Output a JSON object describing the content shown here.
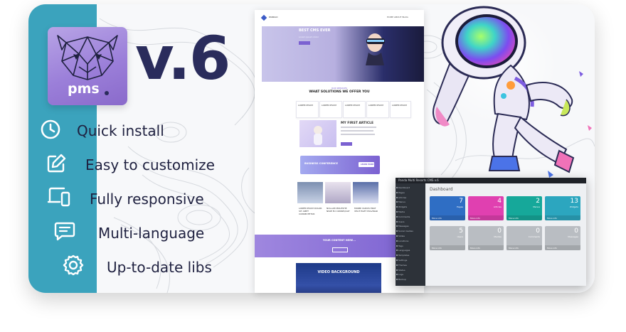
{
  "brand": {
    "logo_text": "pms",
    "version": "v.6",
    "colors": {
      "accent": "#3ba3bd",
      "logo_bg": "#9b7fd9",
      "text_dark": "#2a2c5c"
    }
  },
  "features": [
    {
      "icon": "clock-icon",
      "label": "Quick install"
    },
    {
      "icon": "edit-icon",
      "label": "Easy to customize"
    },
    {
      "icon": "devices-icon",
      "label": "Fully responsive"
    },
    {
      "icon": "chat-icon",
      "label": "Multi-language"
    },
    {
      "icon": "gear-icon",
      "label": "Up-to-date libs"
    }
  ],
  "site_preview": {
    "brand": "PANDAO",
    "nav": "HOME   ABOUT   BLOG",
    "hero_title": "BEST CMS EVER",
    "hero_sub": "Lorem ipsum dolor",
    "kicker": "OUR SERVICES",
    "solutions_title": "WHAT SOLUTIONS WE OFFER YOU",
    "solutions": [
      "LOREM IPSUM",
      "LOREM IPSUM",
      "LOREM IPSUM",
      "LOREM IPSUM",
      "LOREM IPSUM"
    ],
    "article_title": "MY FIRST ARTICLE",
    "banner_title": "BUSINESS CONFERENCE",
    "banner_btn": "LEARN MORE",
    "news": [
      "LOREM IPSUM DOLOR SIT AMET CONSECTETUR",
      "NULLAM MOLESTIE NISIE EU CONSEQUAT",
      "MORBI VARIUS ERAT VELIT EGET PULVINAR"
    ],
    "content_title": "YOUR CONTENT HERE...",
    "video_title": "VIDEO BACKGROUND"
  },
  "admin_preview": {
    "brand": "Panda Multi Resorts CMS v.6",
    "heading": "Dashboard",
    "menu": [
      "Dashboard",
      "Pages",
      "Articles",
      "Menus",
      "Widgets",
      "Media",
      "Comments",
      "Users",
      "Messages",
      "Social medias",
      "Slides",
      "Locations",
      "Tags",
      "Languages",
      "Templates",
      "Settings",
      "Themes",
      "Status",
      "Logs",
      "Backup"
    ],
    "tiles_row1": [
      {
        "num": "7",
        "label": "Pages",
        "color": "#2f6ec4"
      },
      {
        "num": "4",
        "label": "Articles",
        "color": "#e040b0"
      },
      {
        "num": "2",
        "label": "Menus",
        "color": "#16a89a"
      },
      {
        "num": "13",
        "label": "Widgets",
        "color": "#2ca6bf"
      }
    ],
    "tiles_row2": [
      {
        "num": "5",
        "label": "Users",
        "color": "#b9bdc2"
      },
      {
        "num": "0",
        "label": "Medias",
        "color": "#b9bdc2"
      },
      {
        "num": "0",
        "label": "Comments",
        "color": "#b9bdc2"
      },
      {
        "num": "0",
        "label": "Messages",
        "color": "#b9bdc2"
      }
    ],
    "more_label": "More info"
  }
}
